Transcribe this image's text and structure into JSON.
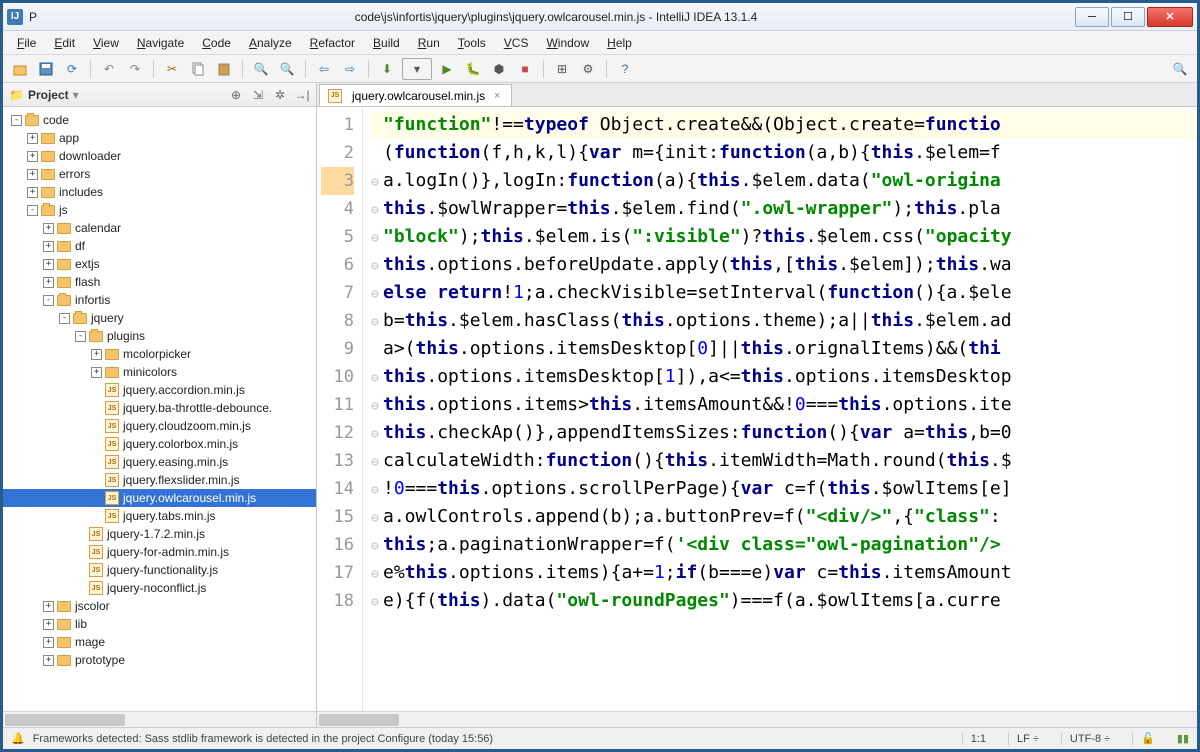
{
  "titlebar": {
    "left": "P",
    "center": "code\\js\\infortis\\jquery\\plugins\\jquery.owlcarousel.min.js - IntelliJ IDEA 13.1.4"
  },
  "menu": [
    "File",
    "Edit",
    "View",
    "Navigate",
    "Code",
    "Analyze",
    "Refactor",
    "Build",
    "Run",
    "Tools",
    "VCS",
    "Window",
    "Help"
  ],
  "sidebar": {
    "title": "Project"
  },
  "tree": [
    {
      "d": 0,
      "t": "folder",
      "open": true,
      "toggle": "-",
      "label": "code"
    },
    {
      "d": 1,
      "t": "folder",
      "open": false,
      "toggle": "+",
      "label": "app"
    },
    {
      "d": 1,
      "t": "folder",
      "open": false,
      "toggle": "+",
      "label": "downloader"
    },
    {
      "d": 1,
      "t": "folder",
      "open": false,
      "toggle": "+",
      "label": "errors"
    },
    {
      "d": 1,
      "t": "folder",
      "open": false,
      "toggle": "+",
      "label": "includes"
    },
    {
      "d": 1,
      "t": "folder",
      "open": true,
      "toggle": "-",
      "label": "js"
    },
    {
      "d": 2,
      "t": "folder",
      "open": false,
      "toggle": "+",
      "label": "calendar"
    },
    {
      "d": 2,
      "t": "folder",
      "open": false,
      "toggle": "+",
      "label": "df"
    },
    {
      "d": 2,
      "t": "folder",
      "open": false,
      "toggle": "+",
      "label": "extjs"
    },
    {
      "d": 2,
      "t": "folder",
      "open": false,
      "toggle": "+",
      "label": "flash"
    },
    {
      "d": 2,
      "t": "folder",
      "open": true,
      "toggle": "-",
      "label": "infortis"
    },
    {
      "d": 3,
      "t": "folder",
      "open": true,
      "toggle": "-",
      "label": "jquery"
    },
    {
      "d": 4,
      "t": "folder",
      "open": true,
      "toggle": "-",
      "label": "plugins"
    },
    {
      "d": 5,
      "t": "folder",
      "open": false,
      "toggle": "+",
      "label": "mcolorpicker"
    },
    {
      "d": 5,
      "t": "folder",
      "open": false,
      "toggle": "+",
      "label": "minicolors"
    },
    {
      "d": 5,
      "t": "js",
      "label": "jquery.accordion.min.js"
    },
    {
      "d": 5,
      "t": "js",
      "label": "jquery.ba-throttle-debounce."
    },
    {
      "d": 5,
      "t": "js",
      "label": "jquery.cloudzoom.min.js"
    },
    {
      "d": 5,
      "t": "js",
      "label": "jquery.colorbox.min.js"
    },
    {
      "d": 5,
      "t": "js",
      "label": "jquery.easing.min.js"
    },
    {
      "d": 5,
      "t": "js",
      "label": "jquery.flexslider.min.js"
    },
    {
      "d": 5,
      "t": "js",
      "label": "jquery.owlcarousel.min.js",
      "selected": true
    },
    {
      "d": 5,
      "t": "js",
      "label": "jquery.tabs.min.js"
    },
    {
      "d": 4,
      "t": "js",
      "label": "jquery-1.7.2.min.js"
    },
    {
      "d": 4,
      "t": "js",
      "label": "jquery-for-admin.min.js"
    },
    {
      "d": 4,
      "t": "js",
      "label": "jquery-functionality.js"
    },
    {
      "d": 4,
      "t": "js",
      "label": "jquery-noconflict.js"
    },
    {
      "d": 2,
      "t": "folder",
      "open": false,
      "toggle": "+",
      "label": "jscolor"
    },
    {
      "d": 2,
      "t": "folder",
      "open": false,
      "toggle": "+",
      "label": "lib"
    },
    {
      "d": 2,
      "t": "folder",
      "open": false,
      "toggle": "+",
      "label": "mage"
    },
    {
      "d": 2,
      "t": "folder",
      "open": false,
      "toggle": "+",
      "label": "prototype"
    }
  ],
  "tab": {
    "label": "jquery.owlcarousel.min.js"
  },
  "gutter": [
    "1",
    "2",
    "3",
    "4",
    "5",
    "6",
    "7",
    "8",
    "9",
    "10",
    "11",
    "12",
    "13",
    "14",
    "15",
    "16",
    "17",
    "18"
  ],
  "code": [
    {
      "html": "<span class='str'>\"function\"</span>!==<span class='kw'>typeof</span> Object.create&&(Object.create=<span class='kw'>functio</span>",
      "bg": "line1-bg"
    },
    {
      "html": "(<span class='kw'>function</span>(f,h,k,l){<span class='kw'>var</span> m={init:<span class='kw'>function</span>(a,b){<span class='this'>this</span>.$elem=f "
    },
    {
      "html": "a.logIn()},logIn:<span class='kw'>function</span>(a){<span class='this'>this</span>.$elem.data(<span class='str'>\"owl-origina</span>",
      "fold": true
    },
    {
      "html": "<span class='this'>this</span>.$owlWrapper=<span class='this'>this</span>.$elem.find(<span class='str'>\".owl-wrapper\"</span>);<span class='this'>this</span>.pla",
      "fold": true
    },
    {
      "html": "<span class='str'>\"block\"</span>);<span class='this'>this</span>.$elem.is(<span class='str'>\":visible\"</span>)?<span class='this'>this</span>.$elem.css(<span class='str'>\"opacity</span>",
      "fold": true
    },
    {
      "html": "<span class='this'>this</span>.options.beforeUpdate.apply(<span class='this'>this</span>,[<span class='this'>this</span>.$elem]);<span class='this'>this</span>.wa",
      "fold": true
    },
    {
      "html": "<span class='kw'>else return</span>!<span class='num'>1</span>;a.checkVisible=setInterval(<span class='kw'>function</span>(){a.$ele",
      "fold": true
    },
    {
      "html": "b=<span class='this'>this</span>.$elem.hasClass(<span class='this'>this</span>.options.theme);a||<span class='this'>this</span>.$elem.ad",
      "fold": true
    },
    {
      "html": "a>(<span class='this'>this</span>.options.itemsDesktop[<span class='num'>0</span>]||<span class='this'>this</span>.orignalItems)&&(<span class='this'>thi</span>"
    },
    {
      "html": "<span class='this'>this</span>.options.itemsDesktop[<span class='num'>1</span>]),a<=<span class='this'>this</span>.options.itemsDesktop",
      "fold": true
    },
    {
      "html": "<span class='this'>this</span>.options.items><span class='this'>this</span>.itemsAmount&&!<span class='num'>0</span>===<span class='this'>this</span>.options.ite",
      "fold": true
    },
    {
      "html": "<span class='this'>this</span>.checkAp()},appendItemsSizes:<span class='kw'>function</span>(){<span class='kw'>var</span> a=<span class='this'>this</span>,b=0",
      "fold": true
    },
    {
      "html": "calculateWidth:<span class='kw'>function</span>(){<span class='this'>this</span>.itemWidth=Math.round(<span class='this'>this</span>.$",
      "fold": true
    },
    {
      "html": "!<span class='num'>0</span>===<span class='this'>this</span>.options.scrollPerPage){<span class='kw'>var</span> c=f(<span class='this'>this</span>.$owlItems[e]",
      "fold": true
    },
    {
      "html": "a.owlControls.append(b);a.buttonPrev=f(<span class='str'>\"&lt;div/&gt;\"</span>,{<span class='str'>\"class\"</span>:",
      "fold": true
    },
    {
      "html": "<span class='this'>this</span>;a.paginationWrapper=f(<span class='str'>'&lt;div class=\"owl-pagination\"/&gt;</span> ",
      "fold": true
    },
    {
      "html": "e%<span class='this'>this</span>.options.items){a+=<span class='num'>1</span>;<span class='kw'>if</span>(b===e)<span class='kw'>var</span> c=<span class='this'>this</span>.itemsAmount",
      "fold": true
    },
    {
      "html": "e){f(<span class='this'>this</span>).data(<span class='str'>\"owl-roundPages\"</span>)===f(a.$owlItems[a.curre",
      "fold": true
    }
  ],
  "status": {
    "msg": "Frameworks detected: Sass stdlib framework is detected in the project Configure (today 15:56)",
    "pos": "1:1",
    "le": "LF",
    "enc": "UTF-8"
  }
}
